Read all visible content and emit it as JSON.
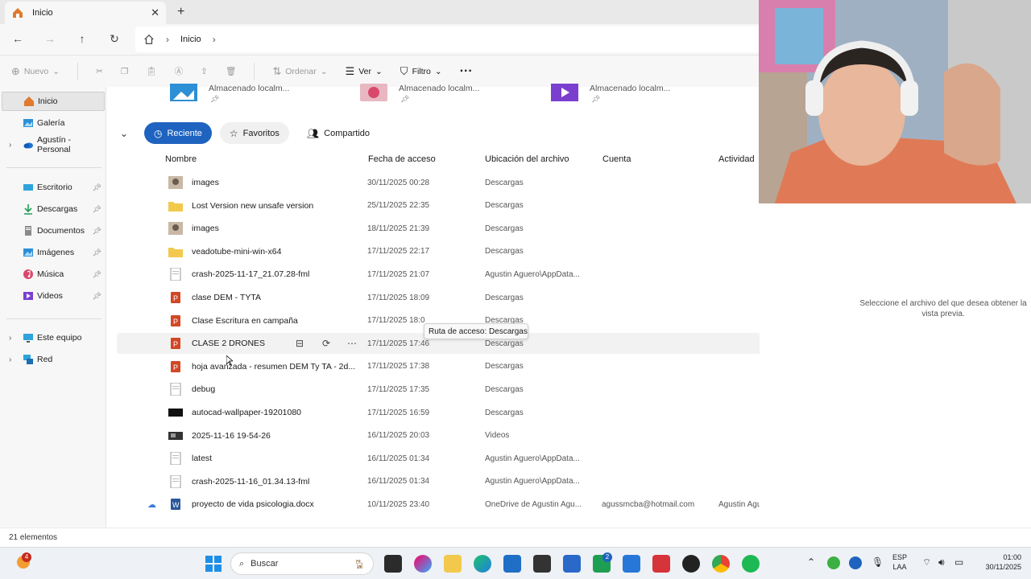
{
  "window": {
    "tab_title": "Inicio",
    "new_tab": "+",
    "close": "✕"
  },
  "address": {
    "crumbs": [
      "Inicio"
    ]
  },
  "commands": {
    "nuevo": "Nuevo",
    "ordenar": "Ordenar",
    "ver": "Ver",
    "filtro": "Filtro",
    "more": "···"
  },
  "sidebar": {
    "items": [
      {
        "label": "Inicio"
      },
      {
        "label": "Galería"
      },
      {
        "label": "Agustín - Personal"
      },
      {
        "label": "Escritorio"
      },
      {
        "label": "Descargas"
      },
      {
        "label": "Documentos"
      },
      {
        "label": "Imágenes"
      },
      {
        "label": "Música"
      },
      {
        "label": "Videos"
      },
      {
        "label": "Este equipo"
      },
      {
        "label": "Red"
      }
    ]
  },
  "quick_access": [
    {
      "label": "Almacenado localm..."
    },
    {
      "label": "Almacenado localm..."
    },
    {
      "label": "Almacenado localm..."
    }
  ],
  "filters": {
    "recent": "Reciente",
    "favorites": "Favoritos",
    "shared": "Compartido"
  },
  "columns": {
    "name": "Nombre",
    "date": "Fecha de acceso",
    "location": "Ubicación del archivo",
    "account": "Cuenta",
    "activity": "Actividad"
  },
  "files": [
    {
      "name": "images",
      "date": "30/11/2025 00:28",
      "location": "Descargas",
      "account": "",
      "activity": "",
      "icon": "image-thumb-icon"
    },
    {
      "name": "Lost Version new unsafe version",
      "date": "25/11/2025 22:35",
      "location": "Descargas",
      "account": "",
      "activity": "",
      "icon": "folder-icon"
    },
    {
      "name": "images",
      "date": "18/11/2025 21:39",
      "location": "Descargas",
      "account": "",
      "activity": "",
      "icon": "image-thumb-icon"
    },
    {
      "name": "veadotube-mini-win-x64",
      "date": "17/11/2025 22:17",
      "location": "Descargas",
      "account": "",
      "activity": "",
      "icon": "folder-icon"
    },
    {
      "name": "crash-2025-11-17_21.07.28-fml",
      "date": "17/11/2025 21:07",
      "location": "Agustin Aguero\\AppData...",
      "account": "",
      "activity": "",
      "icon": "text-file-icon"
    },
    {
      "name": "clase DEM - TYTA",
      "date": "17/11/2025 18:09",
      "location": "Descargas",
      "account": "",
      "activity": "",
      "icon": "powerpoint-icon"
    },
    {
      "name": "Clase Escritura en campaña",
      "date": "17/11/2025 18:0",
      "location": "Descargas",
      "account": "",
      "activity": "",
      "icon": "powerpoint-icon"
    },
    {
      "name": "CLASE 2 DRONES",
      "date": "17/11/2025 17:46",
      "location": "Descargas",
      "account": "",
      "activity": "",
      "icon": "powerpoint-icon"
    },
    {
      "name": "hoja avanzada - resumen DEM Ty TA - 2d...",
      "date": "17/11/2025 17:38",
      "location": "Descargas",
      "account": "",
      "activity": "",
      "icon": "powerpoint-icon"
    },
    {
      "name": "debug",
      "date": "17/11/2025 17:35",
      "location": "Descargas",
      "account": "",
      "activity": "",
      "icon": "text-file-icon"
    },
    {
      "name": "autocad-wallpaper-19201080",
      "date": "17/11/2025 16:59",
      "location": "Descargas",
      "account": "",
      "activity": "",
      "icon": "dark-image-icon"
    },
    {
      "name": "2025-11-16 19-54-26",
      "date": "16/11/2025 20:03",
      "location": "Videos",
      "account": "",
      "activity": "",
      "icon": "video-thumb-icon"
    },
    {
      "name": "latest",
      "date": "16/11/2025 01:34",
      "location": "Agustin Aguero\\AppData...",
      "account": "",
      "activity": "",
      "icon": "text-file-icon"
    },
    {
      "name": "crash-2025-11-16_01.34.13-fml",
      "date": "16/11/2025 01:34",
      "location": "Agustin Aguero\\AppData...",
      "account": "",
      "activity": "",
      "icon": "text-file-icon"
    },
    {
      "name": "proyecto de vida psicologia.docx",
      "date": "10/11/2025 23:40",
      "location": "OneDrive de Agustin Agu...",
      "account": "agussmcba@hotmail.com",
      "activity": "Agustin Aguero ha editad...",
      "icon": "word-icon"
    }
  ],
  "tooltip": "Ruta de acceso: Descargas",
  "preview": {
    "message": "Seleccione el archivo del que desea obtener la vista previa."
  },
  "status": {
    "count": "21 elementos"
  },
  "taskbar": {
    "search_placeholder": "Buscar",
    "notif_badge": "4",
    "store_badge": "2",
    "lang_top": "ESP",
    "lang_bottom": "LAA",
    "time": "01:00",
    "date": "30/11/2025"
  },
  "colors": {
    "accent": "#1e63bf",
    "powerpoint": "#d24726",
    "folder": "#f2c94c",
    "word": "#2b579a"
  }
}
